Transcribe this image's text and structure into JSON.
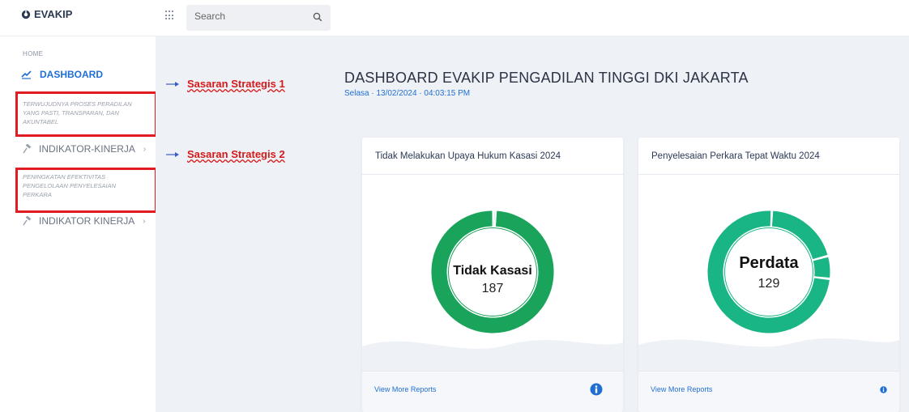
{
  "app": {
    "brand": "EVAKIP"
  },
  "search": {
    "placeholder": "Search"
  },
  "sidebar": {
    "home_label": "HOME",
    "dashboard_label": "DASHBOARD",
    "section1": "TERWUJUDNYA PROSES PERADILAN YANG PASTI, TRANSPARAN, DAN AKUNTABEL",
    "indikator1": "INDIKATOR-KINERJA",
    "section2": "PENINGKATAN EFEKTIVITAS PENGELOLAAN PENYELESAIAN PERKARA",
    "indikator2": "INDIKATOR KINERJA"
  },
  "annotations": {
    "label1": "Sasaran Strategis 1",
    "label2": "Sasaran Strategis 2"
  },
  "main": {
    "title": "DASHBOARD EVAKIP PENGADILAN TINGGI DKI JAKARTA",
    "date": "Selasa · 13/02/2024 · 04:03:15 PM"
  },
  "cards": [
    {
      "title": "Tidak Melakukan Upaya Hukum Kasasi 2024",
      "center_label": "Tidak Kasasi",
      "center_value": "187",
      "footer_link": "View More Reports",
      "donut_color": "#1aa35a",
      "segments_fraction": [
        0.994,
        0.006
      ]
    },
    {
      "title": "Penyelesaian Perkara Tepat Waktu 2024",
      "center_label": "Perdata",
      "center_value": "129",
      "footer_link": "View More Reports",
      "donut_color": "#1ab585",
      "segments_fraction": [
        0.2,
        0.06,
        0.74
      ]
    }
  ],
  "colors": {
    "accent": "#1f6ed4",
    "annotation_red": "#e11b22",
    "background": "#eef1f6"
  }
}
